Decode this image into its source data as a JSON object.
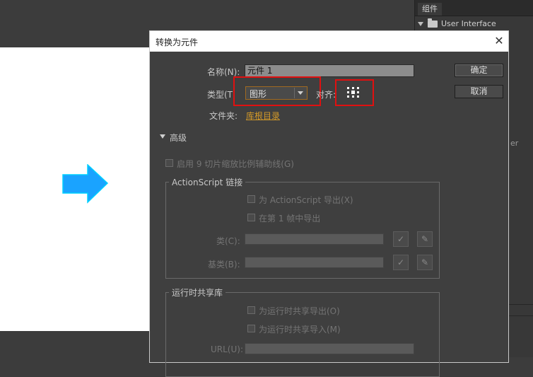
{
  "components_panel": {
    "tab": "组件",
    "tree_item": "User Interface",
    "cut_text": "er"
  },
  "dialog": {
    "title": "转换为元件",
    "close_glyph": "✕",
    "name_label": "名称(N):",
    "name_value": "元件 1",
    "type_label": "类型(T",
    "type_value": "图形",
    "align_label": "对齐:",
    "folder_label": "文件夹:",
    "folder_link": "库根目录",
    "ok_label": "确定",
    "cancel_label": "取消",
    "advanced_label": "高级",
    "scale9_label": "启用 9 切片缩放比例辅助线(G)",
    "as_section": {
      "title": "ActionScript 链接",
      "export_as": "为 ActionScript 导出(X)",
      "export_frame1": "在第 1 帧中导出",
      "class_label": "类(C):",
      "base_label": "基类(B):"
    },
    "rsl_section": {
      "title": "运行时共享库",
      "export_rsl": "为运行时共享导出(O)",
      "import_rsl": "为运行时共享导入(M)",
      "url_label": "URL(U):"
    },
    "check_glyph": "✓",
    "pencil_glyph": "✎"
  },
  "colors": {
    "highlight": "#e01010",
    "folder_link": "#d49a28",
    "arrow": "#1aa3ff"
  }
}
